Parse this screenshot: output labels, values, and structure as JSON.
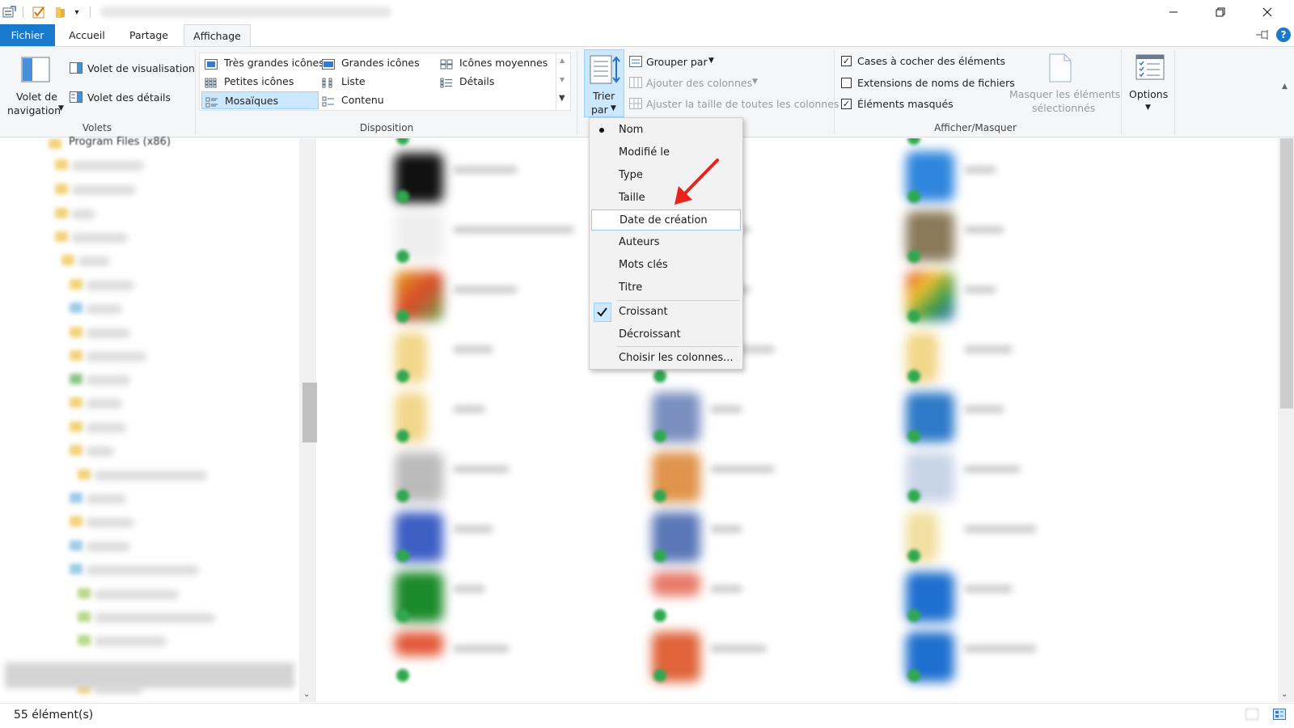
{
  "quick_access": {
    "icons": [
      "properties-icon",
      "checkmark-icon",
      "new-folder-icon",
      "customize-arrow-icon"
    ]
  },
  "tabs": {
    "file": "Fichier",
    "home": "Accueil",
    "share": "Partage",
    "view": "Affichage"
  },
  "ribbon": {
    "panes": {
      "label": "Volets",
      "nav_pane_line1": "Volet de",
      "nav_pane_line2": "navigation",
      "preview_pane": "Volet de visualisation",
      "details_pane": "Volet des détails"
    },
    "layout": {
      "label": "Disposition",
      "items": [
        "Très grandes icônes",
        "Grandes icônes",
        "Icônes moyennes",
        "Petites icônes",
        "Liste",
        "Détails",
        "Mosaïques",
        "Contenu"
      ],
      "selected": "Mosaïques"
    },
    "current_view": {
      "sort_by_line1": "Trier",
      "sort_by_line2": "par",
      "group_by": "Grouper par",
      "add_columns": "Ajouter des colonnes",
      "size_all_columns": "Ajuster la taille de toutes les colonnes"
    },
    "show_hide": {
      "label": "Afficher/Masquer",
      "item_checkboxes": "Cases à cocher des éléments",
      "item_checkboxes_checked": true,
      "file_name_extensions": "Extensions de noms de fichiers",
      "file_name_extensions_checked": false,
      "hidden_items": "Éléments masqués",
      "hidden_items_checked": true,
      "hide_selected_line1": "Masquer les éléments",
      "hide_selected_line2": "sélectionnés"
    },
    "options": "Options"
  },
  "nav_pane": {
    "visible_folder": "Program Files (x86)"
  },
  "sort_menu": {
    "fields": [
      "Nom",
      "Modifié le",
      "Type",
      "Taille",
      "Date de création",
      "Auteurs",
      "Mots clés",
      "Titre"
    ],
    "active_field": "Nom",
    "highlighted": "Date de création",
    "orders": [
      "Croissant",
      "Décroissant"
    ],
    "active_order": "Croissant",
    "choose_columns": "Choisir les colonnes..."
  },
  "status_bar": {
    "item_count": "55 élément(s)"
  },
  "colors": {
    "accent": "#1979ca",
    "selection_fill": "#cce8ff",
    "selection_border": "#99d1ff",
    "annotation_arrow": "#e8231c"
  }
}
